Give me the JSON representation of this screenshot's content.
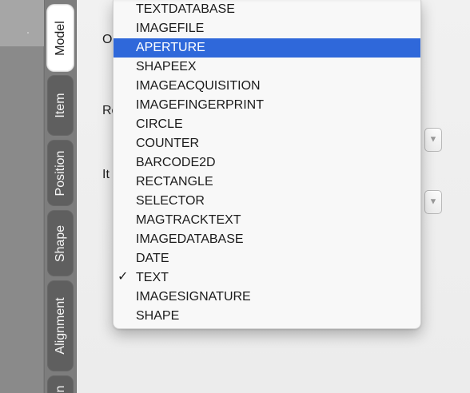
{
  "tabs": [
    {
      "label": "Model",
      "active": true
    },
    {
      "label": "Item",
      "active": false
    },
    {
      "label": "Position",
      "active": false
    },
    {
      "label": "Shape",
      "active": false
    },
    {
      "label": "Alignment",
      "active": false
    },
    {
      "label": "n",
      "active": false
    }
  ],
  "panel": {
    "labels": [
      {
        "text": "O"
      },
      {
        "text": "Re"
      },
      {
        "text": "It"
      }
    ]
  },
  "dropdown": {
    "selected_value": "APERTURE",
    "checked_value": "TEXT",
    "options": [
      {
        "label": "TEXTDATABASE",
        "checked": false,
        "selected": false
      },
      {
        "label": "IMAGEFILE",
        "checked": false,
        "selected": false
      },
      {
        "label": "APERTURE",
        "checked": false,
        "selected": true
      },
      {
        "label": "SHAPEEX",
        "checked": false,
        "selected": false
      },
      {
        "label": "IMAGEACQUISITION",
        "checked": false,
        "selected": false
      },
      {
        "label": "IMAGEFINGERPRINT",
        "checked": false,
        "selected": false
      },
      {
        "label": "CIRCLE",
        "checked": false,
        "selected": false
      },
      {
        "label": "COUNTER",
        "checked": false,
        "selected": false
      },
      {
        "label": "BARCODE2D",
        "checked": false,
        "selected": false
      },
      {
        "label": "RECTANGLE",
        "checked": false,
        "selected": false
      },
      {
        "label": "SELECTOR",
        "checked": false,
        "selected": false
      },
      {
        "label": "MAGTRACKTEXT",
        "checked": false,
        "selected": false
      },
      {
        "label": "IMAGEDATABASE",
        "checked": false,
        "selected": false
      },
      {
        "label": "DATE",
        "checked": false,
        "selected": false
      },
      {
        "label": "TEXT",
        "checked": true,
        "selected": false
      },
      {
        "label": "IMAGESIGNATURE",
        "checked": false,
        "selected": false
      },
      {
        "label": "SHAPE",
        "checked": false,
        "selected": false
      }
    ]
  },
  "icons": {
    "checkmark": "checkmark-icon",
    "select_arrow": "chevron-down-icon"
  },
  "colors": {
    "selection": "#2f68da",
    "tab_active": "#ffffff",
    "tab_inactive": "#5f5f5f"
  }
}
